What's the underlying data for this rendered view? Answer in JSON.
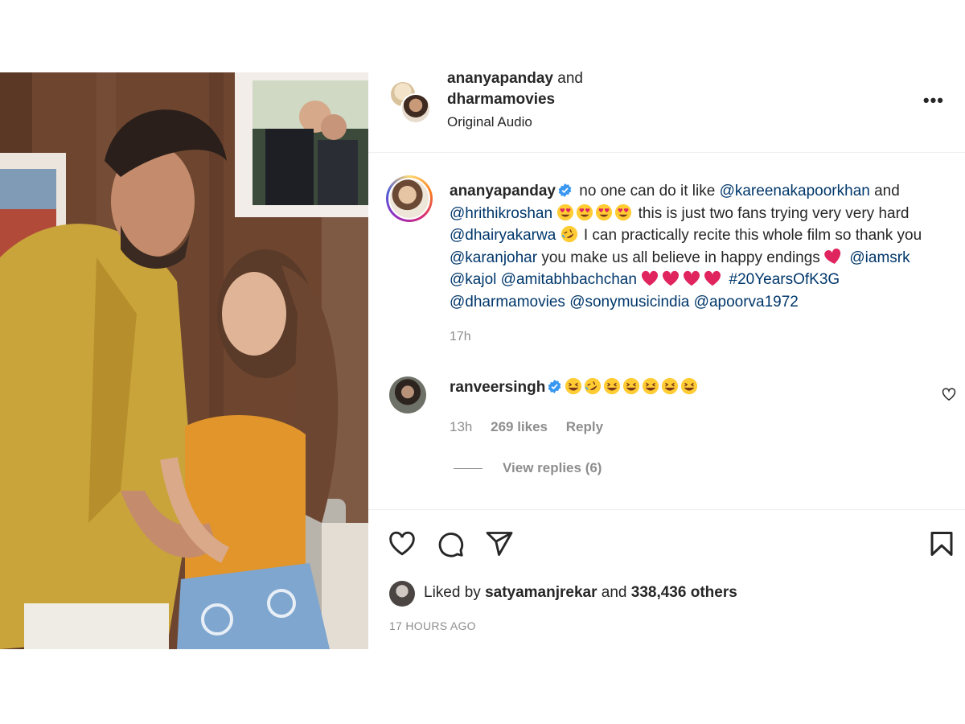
{
  "post": {
    "header": {
      "user1": "ananyapanday",
      "joiner": "and",
      "user2": "dharmamovies",
      "audio": "Original Audio",
      "more_label": "•••"
    },
    "caption": {
      "username": "ananyapanday",
      "text_1": "no one can do it like",
      "mention_kareena": "@kareenakapoorkhan",
      "text_2": "and",
      "mention_hrithik": "@hrithikroshan",
      "text_3": "this is just two fans trying very very hard",
      "mention_dhairya": "@dhairyakarwa",
      "text_4": "I can practically recite this whole film so thank you",
      "mention_karan": "@karanjohar",
      "text_5": "you make us all believe in happy endings",
      "mention_srk": "@iamsrk",
      "mention_kajol": "@kajol",
      "mention_amitabh": "@amitabhbachchan",
      "hashtag": "#20YearsOfK3G",
      "mention_dharma": "@dharmamovies",
      "mention_sony": "@sonymusicindia",
      "mention_apoorva": "@apoorva1972",
      "time": "17h"
    },
    "comment": {
      "username": "ranveersingh",
      "time": "13h",
      "likes": "269 likes",
      "reply": "Reply",
      "view_replies": "View replies (6)"
    },
    "likes": {
      "prefix": "Liked by",
      "user": "satyamanjrekar",
      "middle": "and",
      "others": "338,436 others"
    },
    "posted_ago": "17 HOURS AGO"
  },
  "icons": {
    "verified": "verified-badge-icon",
    "heart_eyes": "heart-eyes-emoji",
    "rofl": "rolling-laughing-emoji",
    "grin": "grinning-squint-emoji",
    "red_heart": "red-heart-emoji",
    "like": "heart-outline-icon",
    "comment": "comment-bubble-icon",
    "share": "paper-plane-icon",
    "save": "bookmark-icon"
  },
  "colors": {
    "text": "#262626",
    "secondary": "#8e8e8e",
    "mention": "#00376b",
    "verified": "#3897f0",
    "emoji_heart": "#e0245e"
  }
}
